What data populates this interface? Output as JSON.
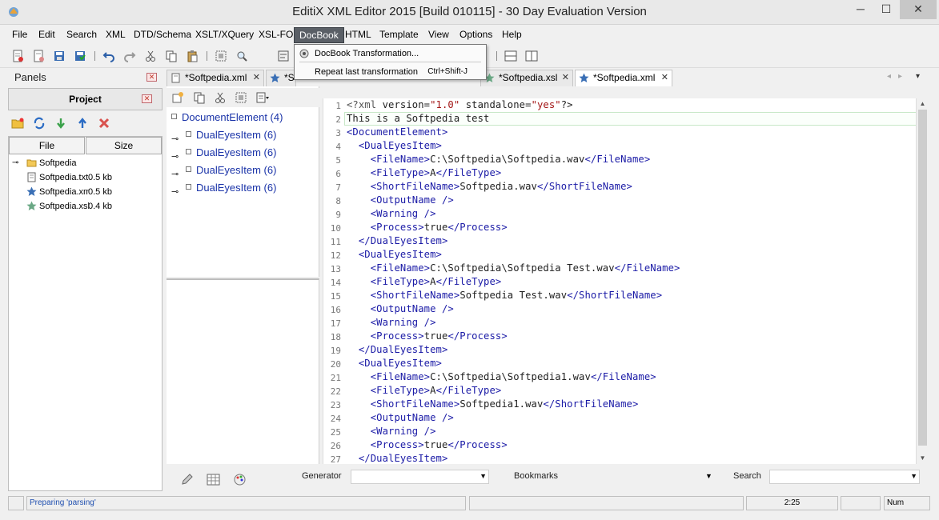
{
  "window": {
    "title": "EditiX XML Editor 2015 [Build 010115] - 30 Day Evaluation Version",
    "minimize": "─",
    "maximize": "☐",
    "close": "✕"
  },
  "menubar": [
    "File",
    "Edit",
    "Search",
    "XML",
    "DTD/Schema",
    "XSLT/XQuery",
    "XSL-FO",
    "DocBook",
    "HTML",
    "Template",
    "View",
    "Options",
    "Help"
  ],
  "active_menu": "DocBook",
  "docbook_menu": {
    "items": [
      {
        "label": "DocBook Transformation...",
        "shortcut": ""
      },
      {
        "label": "Repeat last transformation",
        "shortcut": "Ctrl+Shift-J"
      }
    ]
  },
  "panels": {
    "title": "Panels",
    "project_title": "Project",
    "columns": [
      "File",
      "Size"
    ],
    "tree": [
      {
        "name": "Softpedia",
        "size": "",
        "type": "folder-icon"
      },
      {
        "name": "Softpedia.txt",
        "size": "0.5 kb",
        "type": "text-file-icon"
      },
      {
        "name": "Softpedia.xml",
        "size": "0.5 kb",
        "type": "xml-star-icon"
      },
      {
        "name": "Softpedia.xsl",
        "size": "0.4 kb",
        "type": "xsl-star-icon"
      }
    ]
  },
  "outline": {
    "root": "DocumentElement (4)",
    "items": [
      "DualEyesItem (6)",
      "DualEyesItem (6)",
      "DualEyesItem (6)",
      "DualEyesItem (6)"
    ]
  },
  "tabs": [
    {
      "label": "*Softpedia.xml",
      "icon": "text-file-icon",
      "active": false
    },
    {
      "label": "*Sof",
      "icon": "xml-star-icon",
      "active": false
    },
    {
      "label": "*Softpedia.xsl",
      "icon": "xsl-star-icon",
      "active": false
    },
    {
      "label": "*Softpedia.xml",
      "icon": "xml-star-icon",
      "active": true
    }
  ],
  "tab_close": "✕",
  "editor": {
    "lines": [
      "<?xml version=\"1.0\" standalone=\"yes\"?>",
      "This is a Softpedia test",
      "<DocumentElement>",
      "  <DualEyesItem>",
      "    <FileName>C:\\Softpedia\\Softpedia.wav</FileName>",
      "    <FileType>A</FileType>",
      "    <ShortFileName>Softpedia.wav</ShortFileName>",
      "    <OutputName />",
      "    <Warning />",
      "    <Process>true</Process>",
      "  </DualEyesItem>",
      "  <DualEyesItem>",
      "    <FileName>C:\\Softpedia\\Softpedia Test.wav</FileName>",
      "    <FileType>A</FileType>",
      "    <ShortFileName>Softpedia Test.wav</ShortFileName>",
      "    <OutputName />",
      "    <Warning />",
      "    <Process>true</Process>",
      "  </DualEyesItem>",
      "  <DualEyesItem>",
      "    <FileName>C:\\Softpedia\\Softpedia1.wav</FileName>",
      "    <FileType>A</FileType>",
      "    <ShortFileName>Softpedia1.wav</ShortFileName>",
      "    <OutputName />",
      "    <Warning />",
      "    <Process>true</Process>",
      "  </DualEyesItem>"
    ]
  },
  "bottom": {
    "generator_label": "Generator",
    "generator_value": "",
    "bookmarks_label": "Bookmarks",
    "search_label": "Search",
    "search_value": ""
  },
  "status": {
    "message": "Preparing 'parsing'",
    "position": "2:25",
    "num": "Num"
  },
  "colors": {
    "tag": "#1a1aa6",
    "string": "#a31515",
    "outline_text": "#1a33a8",
    "active_menu_bg": "#5a5f66"
  }
}
